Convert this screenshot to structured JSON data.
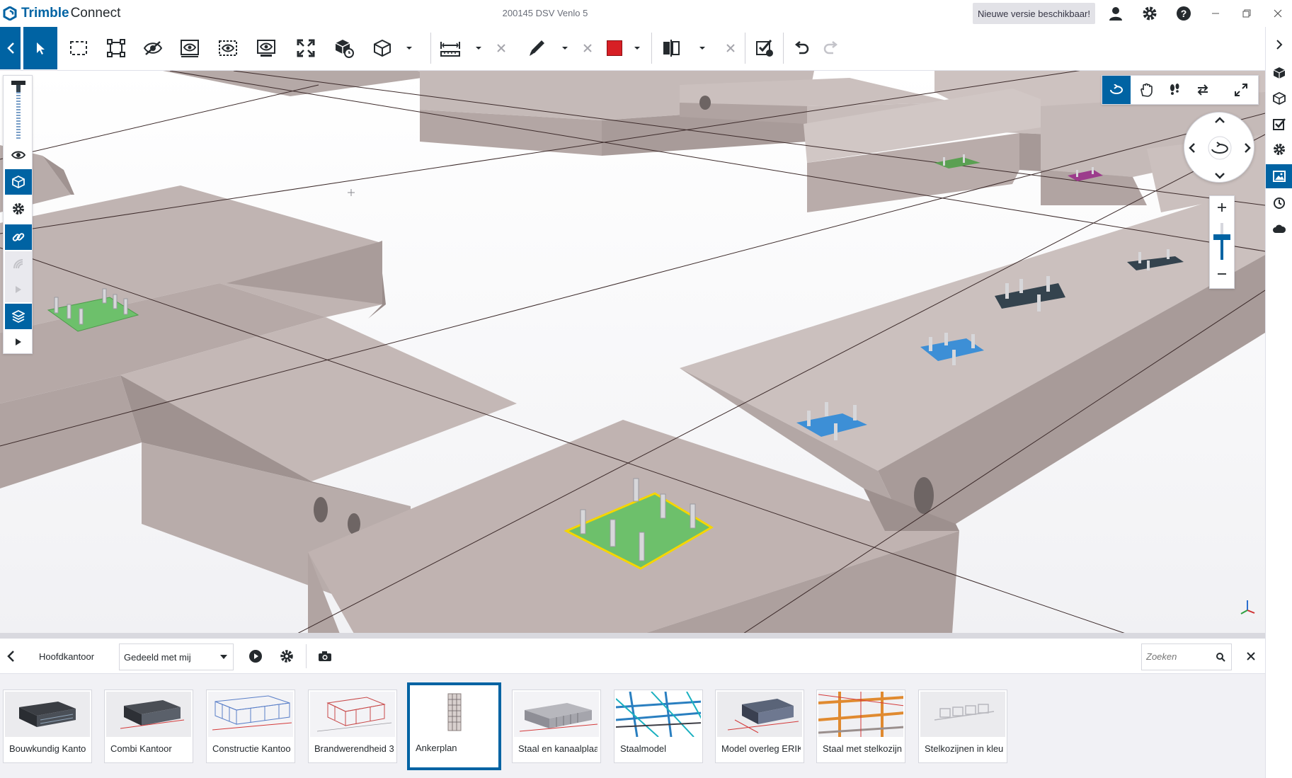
{
  "app": {
    "brand": "Trimble",
    "product": "Connect",
    "project_title": "200145 DSV Venlo 5",
    "update_banner": "Nieuwe versie beschikbaar!"
  },
  "titlebar_icons": [
    "user-icon",
    "gear-icon",
    "help-icon",
    "minimize-icon",
    "restore-icon",
    "close-icon"
  ],
  "toolbar": {
    "tools": [
      "select-arrow-icon",
      "area-select-icon",
      "box-select-icon",
      "hide-icon",
      "isolate-icon",
      "show-only-icon",
      "show-all-icon",
      "fit-to-view-icon",
      "object-add-icon",
      "cube-view-icon",
      "measure-icon",
      "markup-pen-icon",
      "color-swatch-icon",
      "section-plane-icon",
      "checklist-icon",
      "undo-icon",
      "redo-icon"
    ],
    "markup_color": "#d71f25"
  },
  "viewport": {
    "nav_modes": [
      "orbit-icon",
      "pan-icon",
      "walk-icon",
      "swap-icon",
      "fullscreen-icon"
    ]
  },
  "views_panel": {
    "folder": "Hoofdkantoor",
    "filter": "Gedeeld met mij",
    "search_placeholder": "Zoeken",
    "views": [
      {
        "label": "Bouwkundig Kanto",
        "selected": false
      },
      {
        "label": "Combi Kantoor",
        "selected": false
      },
      {
        "label": "Constructie Kantoo",
        "selected": false
      },
      {
        "label": "Brandwerendheid 3",
        "selected": false
      },
      {
        "label": "Ankerplan",
        "selected": true
      },
      {
        "label": "Staal en kanaalplaa",
        "selected": false
      },
      {
        "label": "Staalmodel",
        "selected": false
      },
      {
        "label": "Model overleg ERIK",
        "selected": false
      },
      {
        "label": "Staal met stelkozijn",
        "selected": false
      },
      {
        "label": "Stelkozijnen in kleu",
        "selected": false
      }
    ]
  },
  "colors": {
    "accent": "#0063a3",
    "concrete": "#b8aaa8",
    "plate_green": "#6dc06b",
    "plate_blue": "#3d8fd6",
    "plate_dark": "#34434e",
    "selection": "#f5d600"
  }
}
